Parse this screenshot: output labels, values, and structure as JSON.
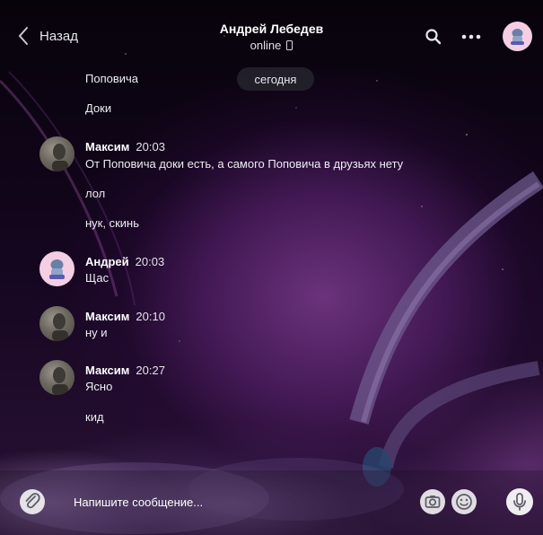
{
  "header": {
    "back_label": "Назад",
    "contact_name": "Андрей Лебедев",
    "status": "online"
  },
  "date_divider": "сегодня",
  "messages": [
    {
      "text": "Поповича"
    },
    {
      "text": "Доки"
    },
    {
      "author": "Максим",
      "time": "20:03",
      "text": "От Поповича доки есть, а самого Поповича в друзьях нету"
    },
    {
      "text": "лол"
    },
    {
      "text": "нук, скинь"
    },
    {
      "author": "Андрей",
      "time": "20:03",
      "text": "Щас"
    },
    {
      "author": "Максим",
      "time": "20:10",
      "text": "ну и"
    },
    {
      "author": "Максим",
      "time": "20:27",
      "text": "Ясно"
    },
    {
      "text": "кид"
    }
  ],
  "composer": {
    "placeholder": "Напишите сообщение..."
  },
  "icons": {
    "back": "chevron-left-icon",
    "search": "search-icon",
    "more": "more-dots-icon",
    "phone": "phone-icon",
    "attach": "paperclip-icon",
    "camera": "camera-icon",
    "emoji": "emoji-icon",
    "mic": "microphone-icon"
  },
  "colors": {
    "background_dark": "#07030a",
    "planet": "#7a3a8c",
    "text": "#ededf2",
    "accent_avatar": "#f4cfe4"
  }
}
